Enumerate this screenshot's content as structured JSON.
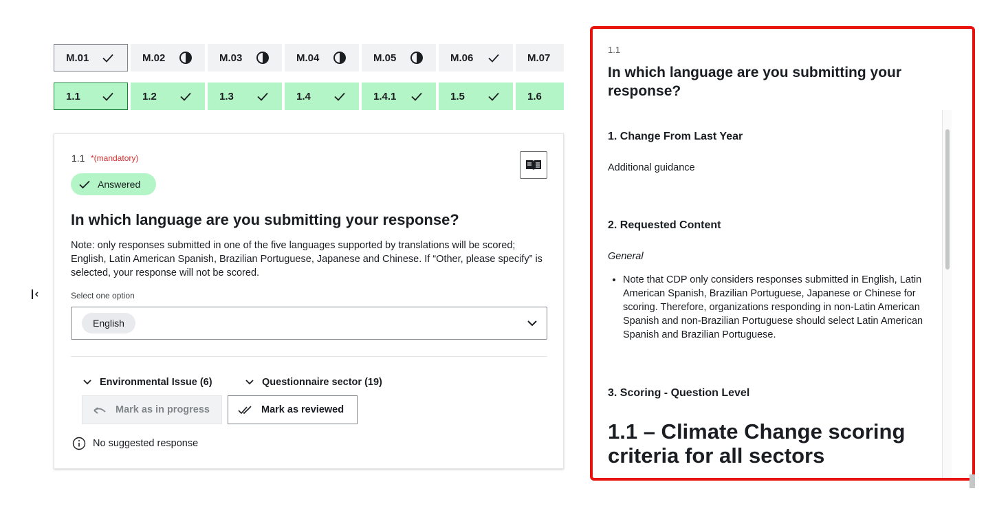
{
  "module_tabs": [
    {
      "label": "M.01",
      "status": "complete",
      "icon": "check-icon"
    },
    {
      "label": "M.02",
      "status": "partial",
      "icon": "progress-pie-icon"
    },
    {
      "label": "M.03",
      "status": "partial",
      "icon": "progress-pie-icon"
    },
    {
      "label": "M.04",
      "status": "partial",
      "icon": "progress-pie-icon"
    },
    {
      "label": "M.05",
      "status": "partial",
      "icon": "progress-pie-icon"
    },
    {
      "label": "M.06",
      "status": "complete",
      "icon": "check-icon"
    },
    {
      "label": "M.07",
      "status": "partial",
      "icon": "progress-pie-icon"
    }
  ],
  "question_tabs": [
    {
      "label": "1.1",
      "icon": "check-icon"
    },
    {
      "label": "1.2",
      "icon": "check-icon"
    },
    {
      "label": "1.3",
      "icon": "check-icon"
    },
    {
      "label": "1.4",
      "icon": "check-icon"
    },
    {
      "label": "1.4.1",
      "icon": "check-icon"
    },
    {
      "label": "1.5",
      "icon": "check-icon"
    },
    {
      "label": "1.6",
      "icon": "check-icon"
    }
  ],
  "question": {
    "number": "1.1",
    "mandatory": "*(mandatory)",
    "status": "Answered",
    "title": "In which language are you submitting your response?",
    "note": "Note: only responses submitted in one of the five languages supported by translations will be scored; English, Latin American Spanish, Brazilian Portuguese, Japanese and Chinese. If “Other, please specify” is selected, your response will not be scored.",
    "select_label": "Select one option",
    "selected": "English",
    "env_issue": "Environmental Issue (6)",
    "sector": "Questionnaire sector (19)",
    "mark_progress": "Mark as in progress",
    "mark_reviewed": "Mark as reviewed",
    "no_suggestion": "No suggested response"
  },
  "guidance": {
    "number": "1.1",
    "title": "In which language are you submitting your response?",
    "sec1": "1. Change From Last Year",
    "sec1_text": "Additional guidance",
    "sec2": "2. Requested Content",
    "sec2_sub": "General",
    "sec2_bullet": "Note that CDP only considers responses submitted in English, Latin American Spanish, Brazilian Portuguese, Japanese or Chinese for scoring. Therefore, organizations responding in non-Latin American Spanish and non-Brazilian Portuguese should select Latin American Spanish and Brazilian Portuguese.",
    "sec3": "3. Scoring - Question Level",
    "big_heading": "1.1 – Climate Change scoring criteria for all sectors"
  },
  "colors": {
    "complete_green": "#b4f5c7",
    "highlight_red": "#e8120d",
    "mandatory_red": "#d32f2f"
  }
}
